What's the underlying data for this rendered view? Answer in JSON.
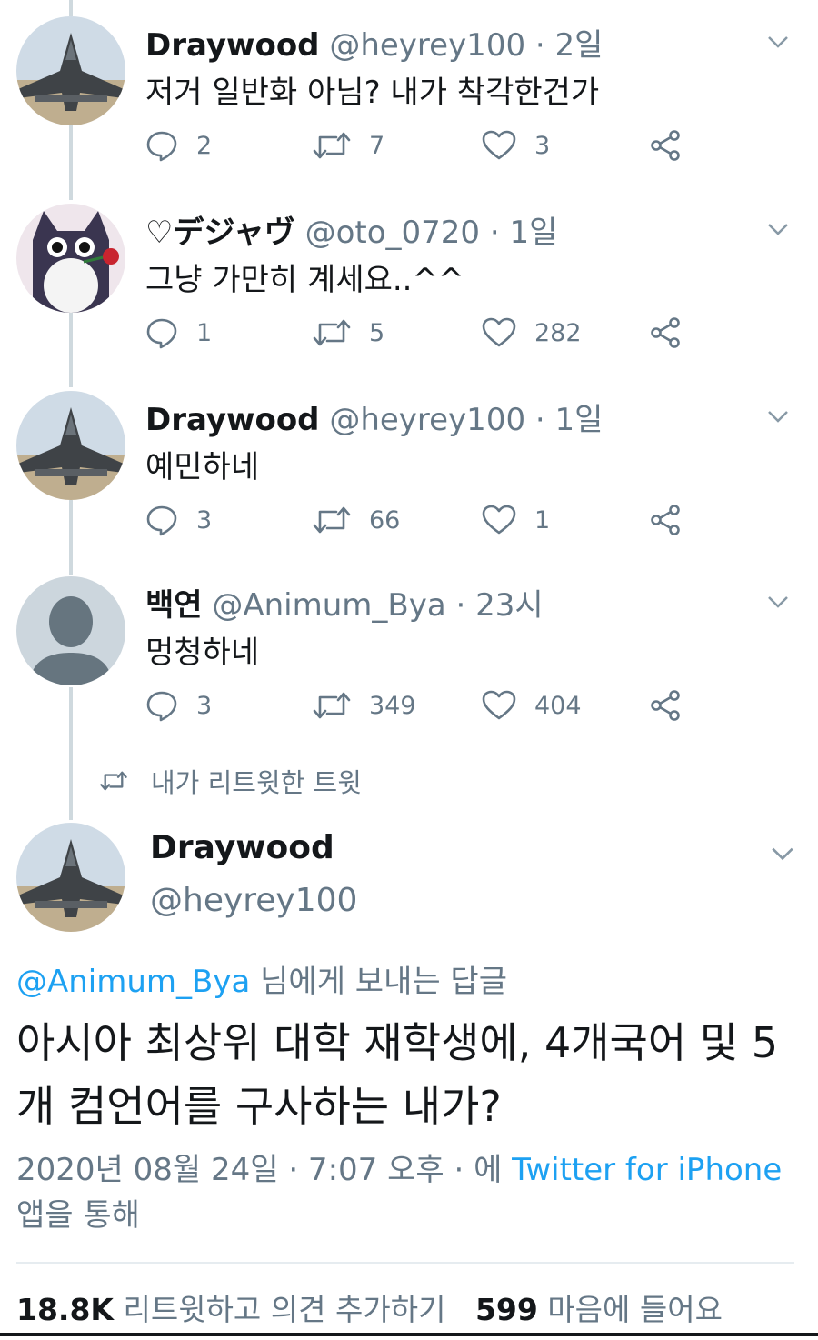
{
  "thread": [
    {
      "name": "Draywood",
      "handle": "@heyrey100",
      "time": "2일",
      "text": "저거 일반화 아님? 내가 착각한건가",
      "replies": "2",
      "retweets": "7",
      "likes": "3",
      "avatar": "jet"
    },
    {
      "name": "♡デジャヴ",
      "handle": "@oto_0720",
      "time": "1일",
      "text": "그냥 가만히 계세요..^^",
      "replies": "1",
      "retweets": "5",
      "likes": "282",
      "avatar": "cat"
    },
    {
      "name": "Draywood",
      "handle": "@heyrey100",
      "time": "1일",
      "text": "예민하네",
      "replies": "3",
      "retweets": "66",
      "likes": "1",
      "avatar": "jet"
    },
    {
      "name": "백연",
      "handle": "@Animum_Bya",
      "time": "23시",
      "text": "멍청하네",
      "replies": "3",
      "retweets": "349",
      "likes": "404",
      "avatar": "default"
    }
  ],
  "separator": "·",
  "retweeted_label": "내가 리트윗한 트윗",
  "main": {
    "name": "Draywood",
    "handle": "@heyrey100",
    "reply_to_handle": "@Animum_Bya",
    "reply_to_suffix": " 님에게 보내는 답글",
    "text": "아시아 최상위 대학 재학생에, 4개국어 및 5개 컴언어를 구사하는 내가?",
    "timestamp": "2020년 08월 24일 · 7:07 오후 · 에 ",
    "source": "Twitter for iPhone",
    "source_suffix": " 앱을 통해",
    "retweet_count": "18.8K",
    "retweet_label": " 리트윗하고 의견 추가하기",
    "like_count": "599",
    "like_label": " 마음에 들어요"
  },
  "colors": {
    "accent": "#1da1f2",
    "muted": "#657786",
    "thread_line": "#cfd9de"
  }
}
